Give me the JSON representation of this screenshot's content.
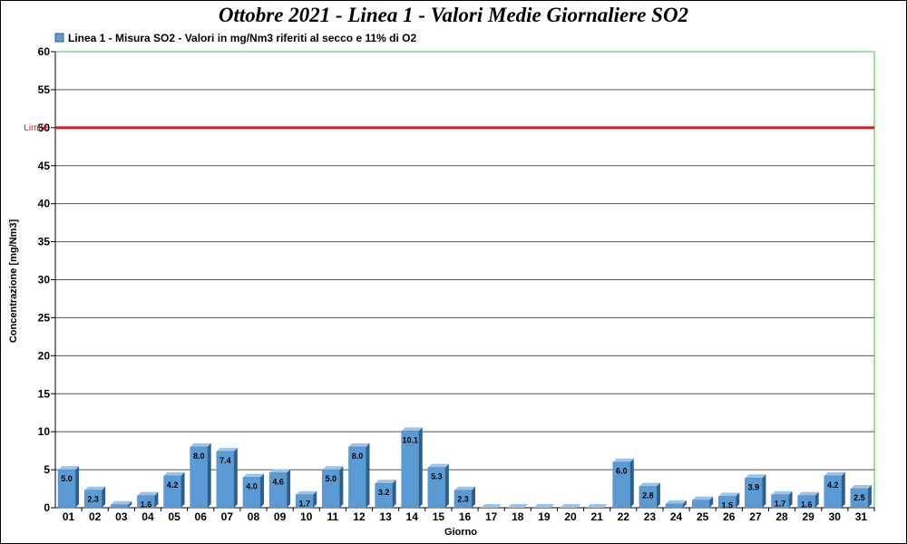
{
  "chart_data": {
    "type": "bar",
    "title": "Ottobre 2021 - Linea 1 - Valori Medie Giornaliere SO2",
    "xlabel": "Giorno",
    "ylabel": "Concentrazione [mg/Nm3]",
    "ylim": [
      0,
      60
    ],
    "yticks": [
      0,
      5,
      10,
      15,
      20,
      25,
      30,
      35,
      40,
      45,
      50,
      55,
      60
    ],
    "grid": true,
    "legend_position": "top-left",
    "limit": {
      "label": "Limite",
      "value": 50,
      "color": "#e8101a"
    },
    "categories": [
      "01",
      "02",
      "03",
      "04",
      "05",
      "06",
      "07",
      "08",
      "09",
      "10",
      "11",
      "12",
      "13",
      "14",
      "15",
      "16",
      "17",
      "18",
      "19",
      "20",
      "21",
      "22",
      "23",
      "24",
      "25",
      "26",
      "27",
      "28",
      "29",
      "30",
      "31"
    ],
    "series": [
      {
        "name": "Linea 1 - Misura SO2 - Valori in mg/Nm3 riferiti al secco e 11% di O2",
        "color": "#5b9bd5",
        "values": [
          5.0,
          2.3,
          0.4,
          1.6,
          4.2,
          8.0,
          7.4,
          4.0,
          4.6,
          1.7,
          5.0,
          8.0,
          3.2,
          10.1,
          5.3,
          2.3,
          0,
          0,
          0,
          0,
          0,
          6.0,
          2.8,
          0.5,
          1.0,
          1.5,
          3.9,
          1.7,
          1.6,
          4.2,
          2.5
        ],
        "labels": [
          "5.0",
          "2.3",
          "",
          "1.6",
          "4.2",
          "8.0",
          "7.4",
          "4.0",
          "4.6",
          "1.7",
          "5.0",
          "8.0",
          "3.2",
          "10.1",
          "5.3",
          "2.3",
          "",
          "",
          "",
          "",
          "",
          "6.0",
          "2.8",
          "",
          "",
          "1.5",
          "3.9",
          "1.7",
          "1.6",
          "4.2",
          "2.5"
        ]
      }
    ]
  },
  "colors": {
    "plot_border": "#33cc33",
    "grid": "#555555",
    "bar_front": "#5b9bd5",
    "bar_top": "#9cc3ea",
    "bar_side": "#2e5f8c"
  }
}
